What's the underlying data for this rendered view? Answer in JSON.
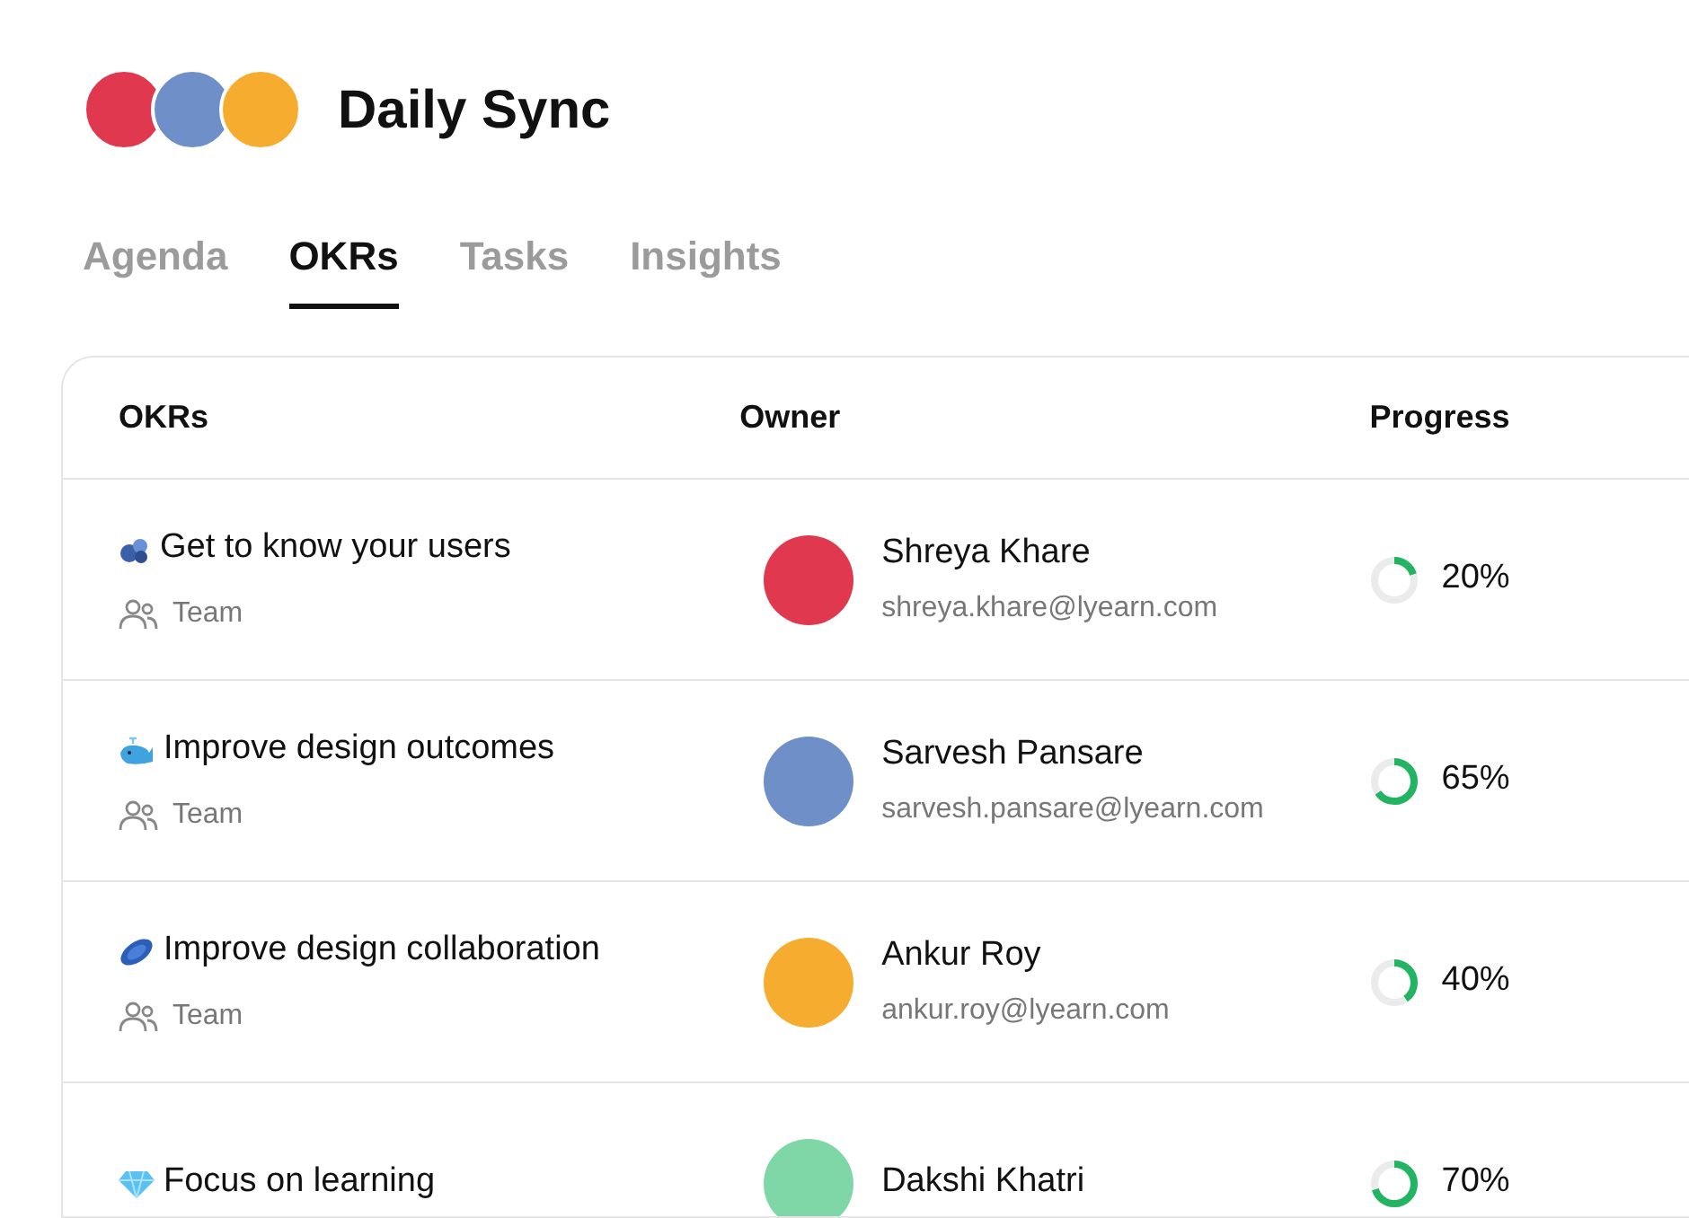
{
  "header": {
    "title": "Daily Sync",
    "participants": [
      {
        "color": "#e0394f"
      },
      {
        "color": "#6f8fc9"
      },
      {
        "color": "#f6ad2f"
      }
    ]
  },
  "tabs": [
    {
      "label": "Agenda",
      "selected": false
    },
    {
      "label": "OKRs",
      "selected": true
    },
    {
      "label": "Tasks",
      "selected": false
    },
    {
      "label": "Insights",
      "selected": false
    }
  ],
  "table": {
    "columns": [
      "OKRs",
      "Owner",
      "Progress"
    ],
    "rows": [
      {
        "title": "Get to know your users",
        "scope": "Team",
        "owner": {
          "name": "Shreya Khare",
          "email": "shreya.khare@lyearn.com",
          "color": "#e0394f"
        },
        "level": 0.2,
        "reading": "20%"
      },
      {
        "title": "Improve design outcomes",
        "scope": "Team",
        "owner": {
          "name": "Sarvesh Pansare",
          "email": "sarvesh.pansare@lyearn.com",
          "color": "#6f8fc9"
        },
        "level": 0.65,
        "reading": "65%"
      },
      {
        "title": "Improve design collaboration",
        "scope": "Team",
        "owner": {
          "name": "Ankur Roy",
          "email": "ankur.roy@lyearn.com",
          "color": "#f6ad2f"
        },
        "level": 0.4,
        "reading": "40%"
      },
      {
        "title": "Focus on learning",
        "owner": {
          "name": "Dakshi Khatri",
          "color": "#7fd6a6"
        },
        "level": 0.7,
        "reading": "70%"
      }
    ]
  }
}
